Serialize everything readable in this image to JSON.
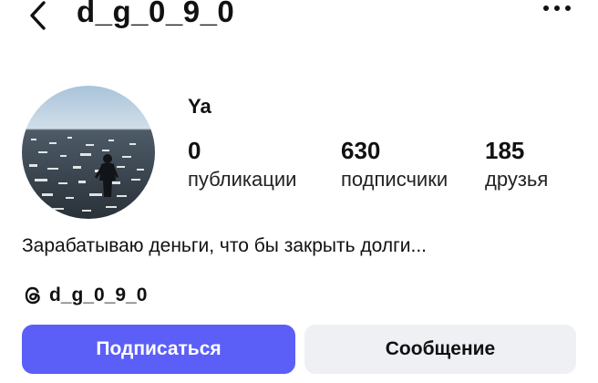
{
  "header": {
    "username": "d_g_0_9_0"
  },
  "profile": {
    "display_name": "Ya",
    "stats": {
      "posts": {
        "count": "0",
        "label": "публикации"
      },
      "followers": {
        "count": "630",
        "label": "подписчики"
      },
      "friends": {
        "count": "185",
        "label": "друзья"
      }
    },
    "bio": "Зарабатываю деньги, что бы закрыть долги...",
    "threads_handle": "d_g_0_9_0"
  },
  "actions": {
    "follow_label": "Подписаться",
    "message_label": "Сообщение"
  },
  "colors": {
    "accent": "#5b5ff7",
    "secondary_button": "#eef0f4",
    "text": "#111111"
  },
  "icons": {
    "back": "chevron-left-icon",
    "more": "more-horizontal-icon",
    "threads": "threads-icon"
  }
}
